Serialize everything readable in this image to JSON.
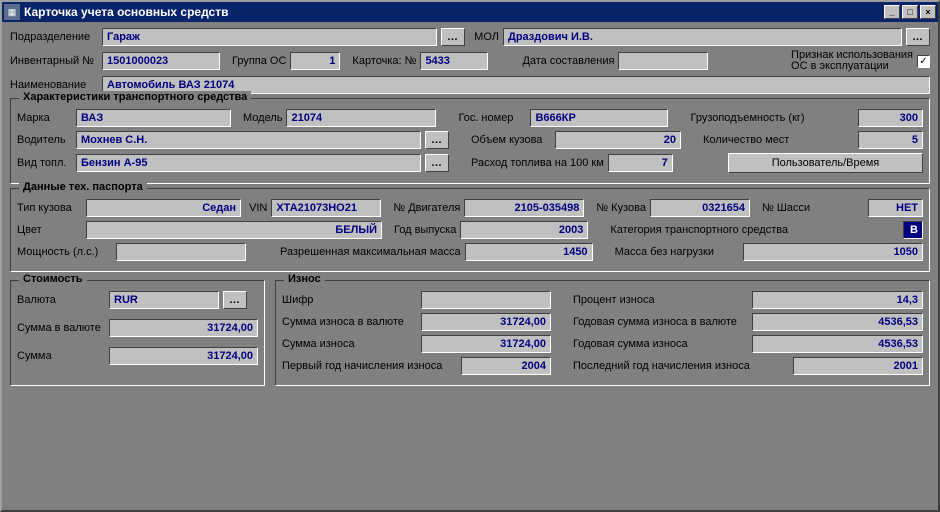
{
  "window": {
    "title": "Карточка учета основных средств"
  },
  "top": {
    "subunit_lbl": "Подразделение",
    "subunit": "Гараж",
    "mol_lbl": "МОЛ",
    "mol": "Драздович И.В.",
    "inv_lbl": "Инвентарный №",
    "inv": "1501000023",
    "group_lbl": "Группа ОС",
    "group": "1",
    "card_lbl": "Карточка: №",
    "card": "5433",
    "date_lbl": "Дата составления",
    "date": "",
    "usage_lbl1": "Признак использования",
    "usage_lbl2": "ОС в эксплуатации",
    "name_lbl": "Наименование",
    "name": "Автомобиль ВАЗ 21074"
  },
  "vehicle": {
    "group_title": "Характеристики транспортного средства",
    "brand_lbl": "Марка",
    "brand": "ВАЗ",
    "model_lbl": "Модель",
    "model": "21074",
    "reg_lbl": "Гос. номер",
    "reg": "В666КР",
    "capacity_lbl": "Грузоподъемность (кг)",
    "capacity": "300",
    "driver_lbl": "Водитель",
    "driver": "Мохнев С.Н.",
    "body_vol_lbl": "Объем кузова",
    "body_vol": "20",
    "seats_lbl": "Количество мест",
    "seats": "5",
    "fuel_lbl": "Вид топл.",
    "fuel": "Бензин А-95",
    "consumption_lbl": "Расход топлива на 100 км",
    "consumption": "7",
    "user_time_btn": "Пользователь/Время"
  },
  "passport": {
    "group_title": "Данные тех. паспорта",
    "body_type_lbl": "Тип кузова",
    "body_type": "Седан",
    "vin_lbl": "VIN",
    "vin": "ХТА21073НО21",
    "engine_lbl": "№ Двигателя",
    "engine": "2105-035498",
    "body_no_lbl": "№ Кузова",
    "body_no": "0321654",
    "chassis_lbl": "№ Шасси",
    "chassis": "НЕТ",
    "color_lbl": "Цвет",
    "color": "БЕЛЫЙ",
    "year_lbl": "Год выпуска",
    "year": "2003",
    "category_lbl": "Категория транспортного средства",
    "category": "B",
    "power_lbl": "Мощность (л.с.)",
    "power": "",
    "max_mass_lbl": "Разрешенная максимальная масса",
    "max_mass": "1450",
    "empty_mass_lbl": "Масса без нагрузки",
    "empty_mass": "1050"
  },
  "cost": {
    "group_title": "Стоимость",
    "currency_lbl": "Валюта",
    "currency": "RUR",
    "sum_cur_lbl": "Сумма в валюте",
    "sum_cur": "31724,00",
    "sum_lbl": "Сумма",
    "sum": "31724,00"
  },
  "wear": {
    "group_title": "Износ",
    "code_lbl": "Шифр",
    "code": "",
    "percent_lbl": "Процент износа",
    "percent": "14,3",
    "wear_sum_cur_lbl": "Сумма износа в валюте",
    "wear_sum_cur": "31724,00",
    "yearly_cur_lbl": "Годовая сумма износа в валюте",
    "yearly_cur": "4536,53",
    "wear_sum_lbl": "Сумма износа",
    "wear_sum": "31724,00",
    "yearly_lbl": "Годовая сумма износа",
    "yearly": "4536,53",
    "first_year_lbl": "Первый год начисления износа",
    "first_year": "2004",
    "last_year_lbl": "Последний год начисления износа",
    "last_year": "2001"
  }
}
